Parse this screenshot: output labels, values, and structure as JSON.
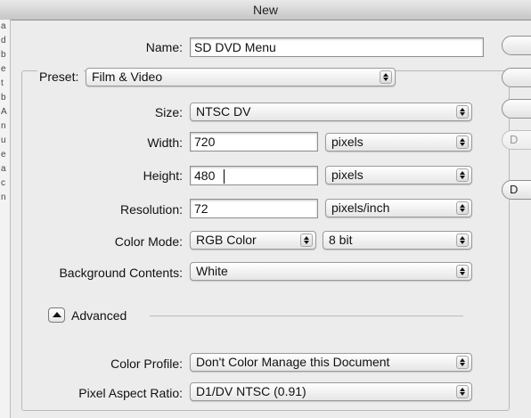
{
  "window": {
    "title": "New"
  },
  "left_strip_chars": [
    "a",
    "d",
    "b",
    "e",
    "t",
    "b",
    "A",
    "n",
    "u",
    "e",
    "a",
    "c",
    "n"
  ],
  "name": {
    "label": "Name:",
    "value": "SD DVD Menu"
  },
  "preset": {
    "label": "Preset:",
    "value": "Film & Video"
  },
  "size": {
    "label": "Size:",
    "value": "NTSC DV"
  },
  "width": {
    "label": "Width:",
    "value": "720",
    "unit": "pixels"
  },
  "height": {
    "label": "Height:",
    "value": "480",
    "unit": "pixels"
  },
  "resolution": {
    "label": "Resolution:",
    "value": "72",
    "unit": "pixels/inch"
  },
  "color_mode": {
    "label": "Color Mode:",
    "value": "RGB Color",
    "depth": "8 bit"
  },
  "background": {
    "label": "Background Contents:",
    "value": "White"
  },
  "advanced": {
    "label": "Advanced"
  },
  "color_profile": {
    "label": "Color Profile:",
    "value": "Don't Color Manage this Document"
  },
  "pixel_aspect": {
    "label": "Pixel Aspect Ratio:",
    "value": "D1/DV NTSC (0.91)"
  },
  "right_buttons": [
    {
      "label": "",
      "disabled": false
    },
    {
      "label": "",
      "disabled": false
    },
    {
      "label": "",
      "disabled": false
    },
    {
      "label": "D",
      "disabled": true
    },
    {
      "label": "D",
      "disabled": false
    }
  ],
  "colors": {
    "window_bg": "#ececec",
    "titlebar_text": "#222222",
    "field_border": "#8e8e8e"
  }
}
